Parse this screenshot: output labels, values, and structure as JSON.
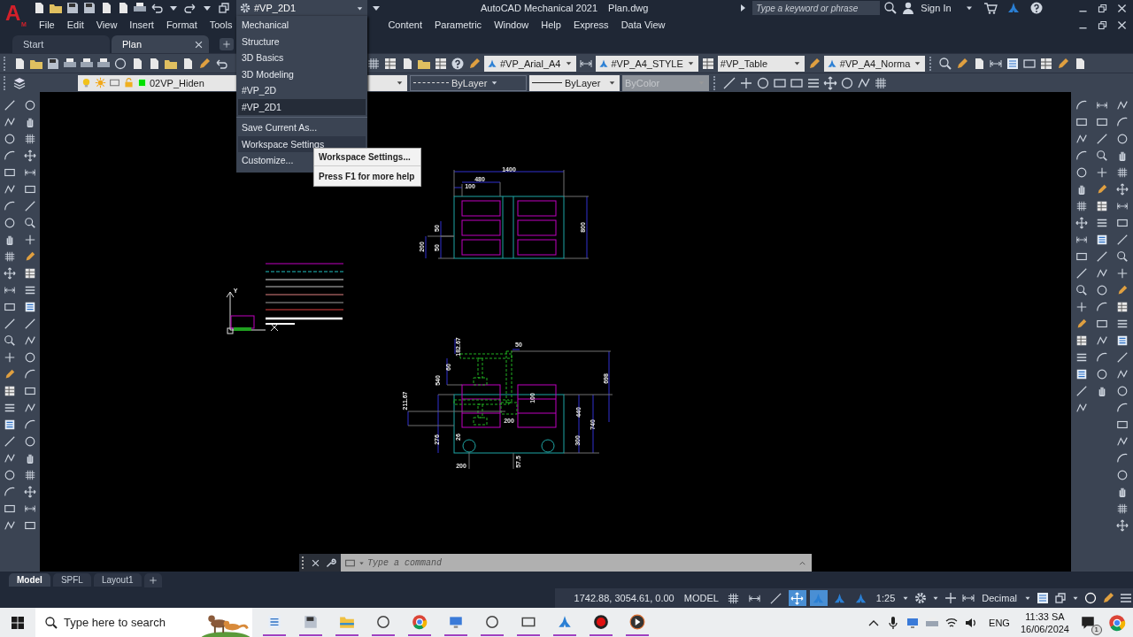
{
  "app_logo": {
    "letter": "A",
    "badge": "M"
  },
  "title_bar": {
    "workspace": "#VP_2D1",
    "app_title": "AutoCAD Mechanical 2021",
    "file_name": "Plan.dwg",
    "search": {
      "placeholder": "Type a keyword or phrase"
    },
    "sign_in": "Sign In"
  },
  "menu_bar": [
    "File",
    "Edit",
    "View",
    "Insert",
    "Format",
    "Tools",
    "Content",
    "Parametric",
    "Window",
    "Help",
    "Express",
    "Data View"
  ],
  "file_tabs": [
    {
      "label": "Start",
      "selected": false
    },
    {
      "label": "Plan",
      "selected": true
    }
  ],
  "style_toolbar": [
    "#VP_Arial_A4",
    "#VP_A4_STYLE",
    "#VP_Table",
    "#VP_A4_Norma"
  ],
  "properties_bar": {
    "layer": "02VP_Hiden",
    "linetype": "ByLayer",
    "lineweight": "ByLayer",
    "plot_style": {
      "value": "ByColor",
      "disabled": true
    }
  },
  "workspace_menu": {
    "items": [
      {
        "label": "Mechanical",
        "selected": false
      },
      {
        "label": "Structure",
        "selected": false
      },
      {
        "label": "3D Basics",
        "selected": false
      },
      {
        "label": "3D Modeling",
        "selected": false
      },
      {
        "label": "#VP_2D",
        "selected": false
      },
      {
        "label": "#VP_2D1",
        "selected": true
      }
    ],
    "actions": [
      {
        "label": "Save Current As...",
        "highlighted": false
      },
      {
        "label": "Workspace Settings",
        "highlighted": true
      },
      {
        "label": "Customize...",
        "highlighted": false
      }
    ]
  },
  "tooltip": {
    "title": "Workspace Settings...",
    "help": "Press F1 for more help"
  },
  "drawing": {
    "ucs_label": "Y",
    "top_view_dimensions": [
      "1400",
      "480",
      "100",
      "50",
      "50",
      "200",
      "800"
    ],
    "front_view_dimensions": [
      "182.67",
      "50",
      "60",
      "540",
      "211.67",
      "100",
      "698",
      "200",
      "440",
      "740",
      "276",
      "26",
      "300",
      "200",
      "57.5"
    ]
  },
  "command_line": {
    "placeholder": "Type a command"
  },
  "layout_tabs": [
    {
      "label": "Model",
      "selected": true
    },
    {
      "label": "SPFL",
      "selected": false
    },
    {
      "label": "Layout1",
      "selected": false
    }
  ],
  "status_bar": {
    "coordinates": "1742.88, 3054.61, 0.00",
    "space": "MODEL",
    "scale": "1:25",
    "units": "Decimal",
    "toggles": [
      {
        "on": false
      },
      {
        "on": false
      },
      {
        "on": false
      },
      {
        "on": true
      },
      {
        "on": true
      },
      {
        "on": false
      },
      {
        "on": false
      }
    ]
  },
  "taskbar": {
    "search": {
      "placeholder": "Type here to search"
    },
    "language": "ENG",
    "time": "11:33 SA",
    "date": "16/06/2024",
    "notifications": "1"
  }
}
